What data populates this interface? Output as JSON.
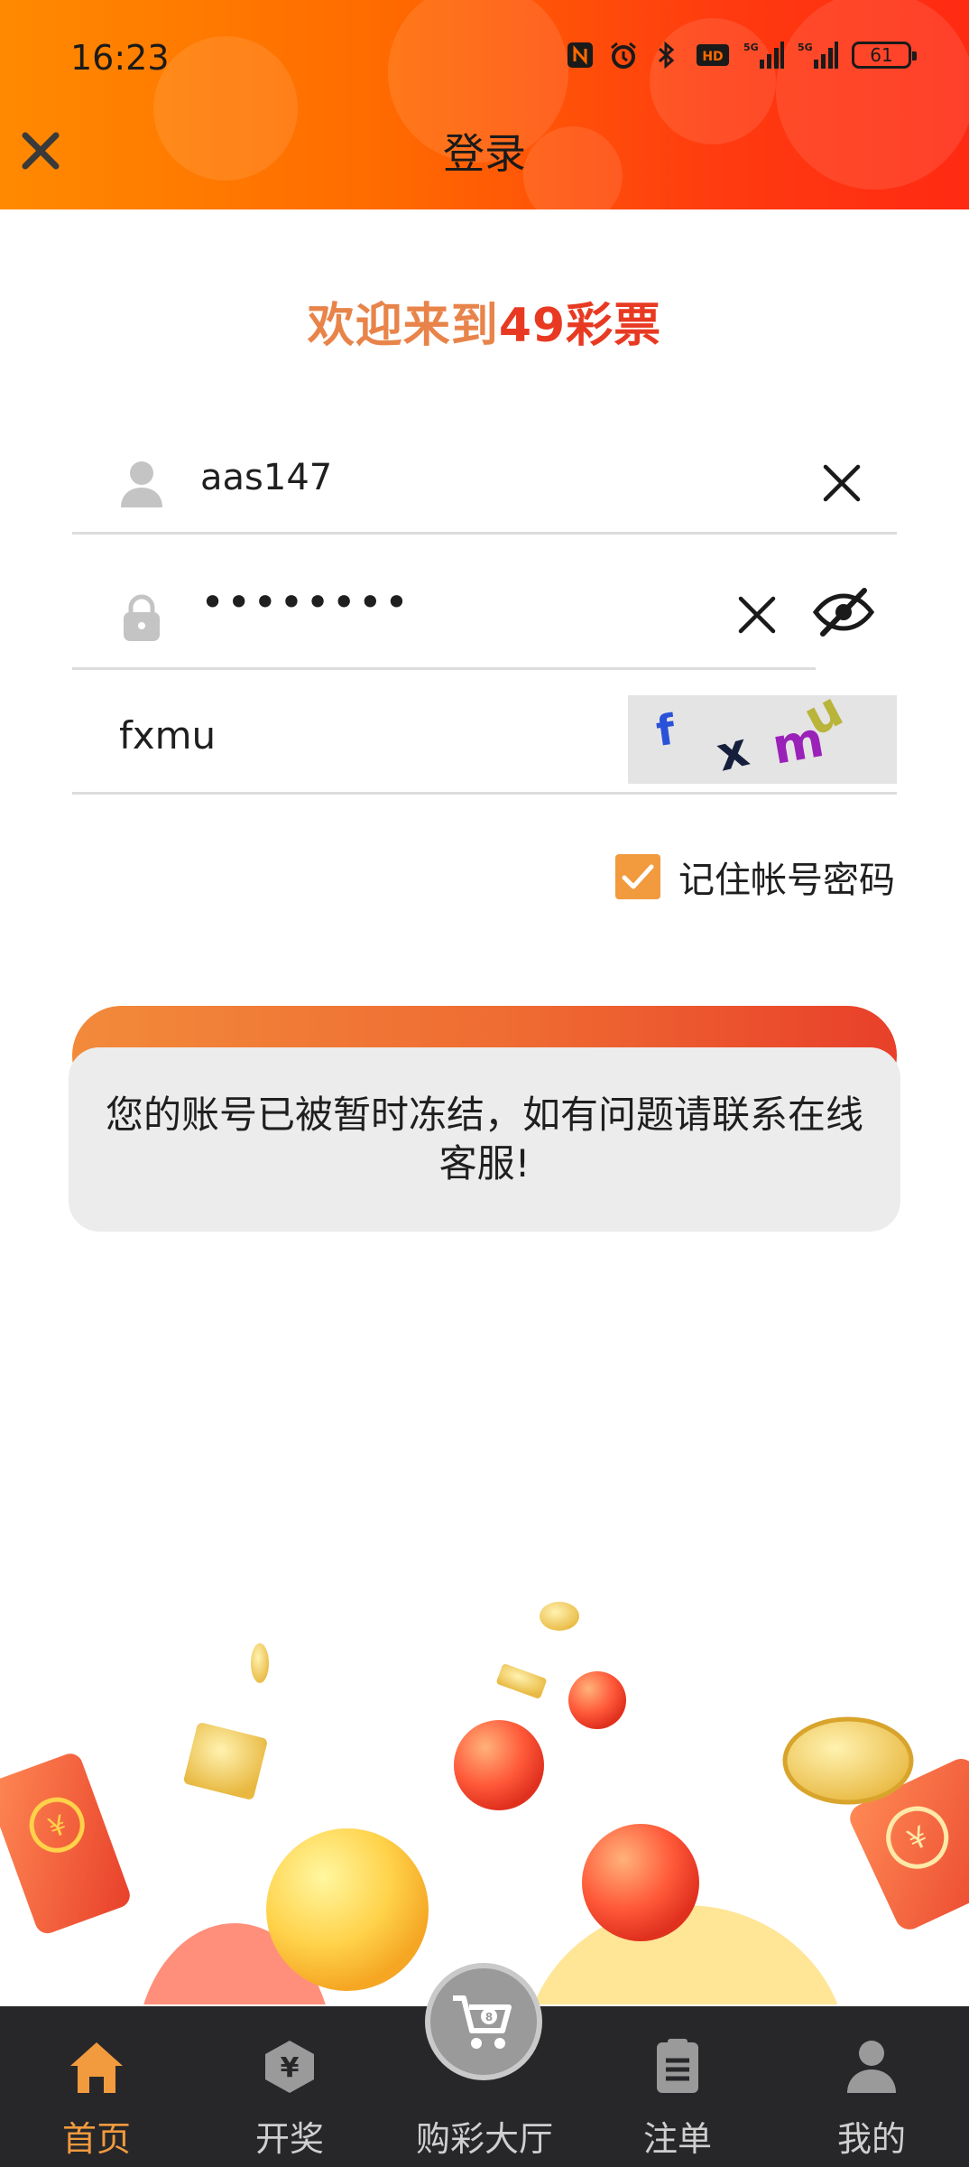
{
  "status_bar": {
    "time": "16:23",
    "battery": "61",
    "icons": [
      "nfc-icon",
      "alarm-icon",
      "bluetooth-icon",
      "hd-icon",
      "signal-5g-icon",
      "signal-5g-icon"
    ]
  },
  "header": {
    "title": "登录",
    "close_icon": "close-icon",
    "gradient": [
      "#ff8a00",
      "#ff2a12"
    ]
  },
  "welcome": {
    "prefix": "欢迎来到",
    "brand": "49彩票",
    "prefix_color": "#e8844a",
    "brand_color": "#e83a22"
  },
  "form": {
    "username": {
      "value": "aas147",
      "icon": "user-icon"
    },
    "password": {
      "value": "••••••••",
      "icon": "lock-icon"
    },
    "captcha": {
      "value": "fxmu",
      "image_text": [
        "f",
        "x",
        "m",
        "u"
      ]
    },
    "remember": {
      "label": "记住帐号密码",
      "checked": true
    }
  },
  "toast": {
    "message": "您的账号已被暂时冻结，如有问题请联系在线客服!"
  },
  "tabbar": {
    "items": [
      {
        "label": "首页",
        "icon": "home-icon",
        "active": true
      },
      {
        "label": "开奖",
        "icon": "lottery-result-icon",
        "active": false
      },
      {
        "label": "购彩大厅",
        "icon": "cart-icon",
        "active": false
      },
      {
        "label": "注单",
        "icon": "clipboard-icon",
        "active": false
      },
      {
        "label": "我的",
        "icon": "profile-icon",
        "active": false
      }
    ],
    "active_color": "#f29a3e"
  }
}
